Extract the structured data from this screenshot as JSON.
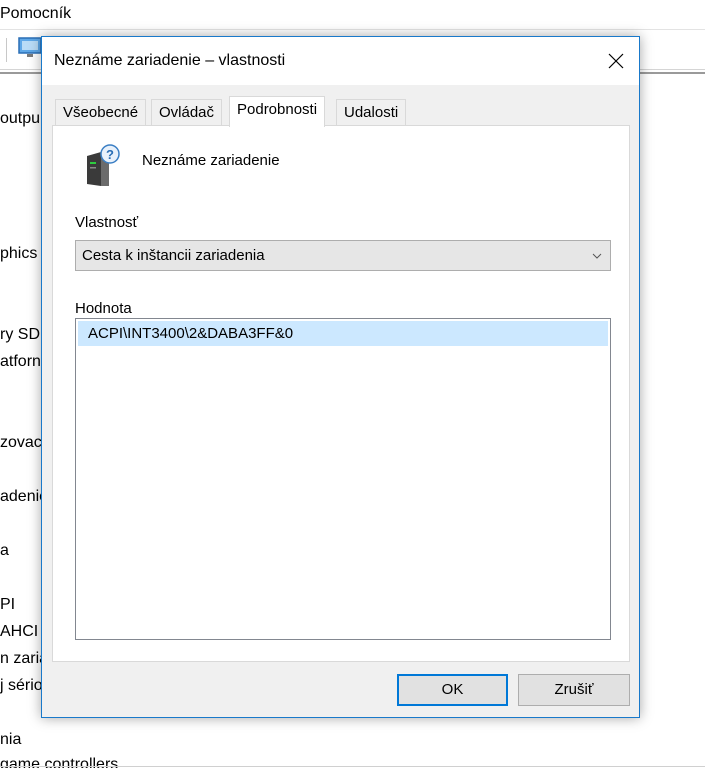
{
  "background_window": {
    "menu_item": "Pomocník",
    "tree_items": [
      {
        "label": "outpu"
      },
      {
        "label": "phics"
      },
      {
        "label": "ry SD"
      },
      {
        "label": "atforn"
      },
      {
        "label": "zovac"
      },
      {
        "label": "adenie"
      },
      {
        "label": "a"
      },
      {
        "label": "PI"
      },
      {
        "label": "AHCI c"
      },
      {
        "label": "n zaria"
      },
      {
        "label": "j sério"
      },
      {
        "label": "nia"
      },
      {
        "label": "game controllers"
      }
    ]
  },
  "dialog": {
    "title": "Neznáme zariadenie – vlastnosti",
    "tabs": [
      {
        "label": "Všeobecné"
      },
      {
        "label": "Ovládač"
      },
      {
        "label": "Podrobnosti"
      },
      {
        "label": "Udalosti"
      }
    ],
    "active_tab": "Podrobnosti",
    "device_name": "Neznáme zariadenie",
    "device_icon": "unknown-device-icon",
    "property_label": "Vlastnosť",
    "property_selected": "Cesta k inštancii zariadenia",
    "value_label": "Hodnota",
    "values": [
      "ACPI\\INT3400\\2&DABA3FF&0"
    ],
    "ok_label": "OK",
    "cancel_label": "Zrušiť"
  },
  "colors": {
    "accent": "#0078d7",
    "selection": "#cce8ff",
    "dialog_border": "#1979ca"
  }
}
